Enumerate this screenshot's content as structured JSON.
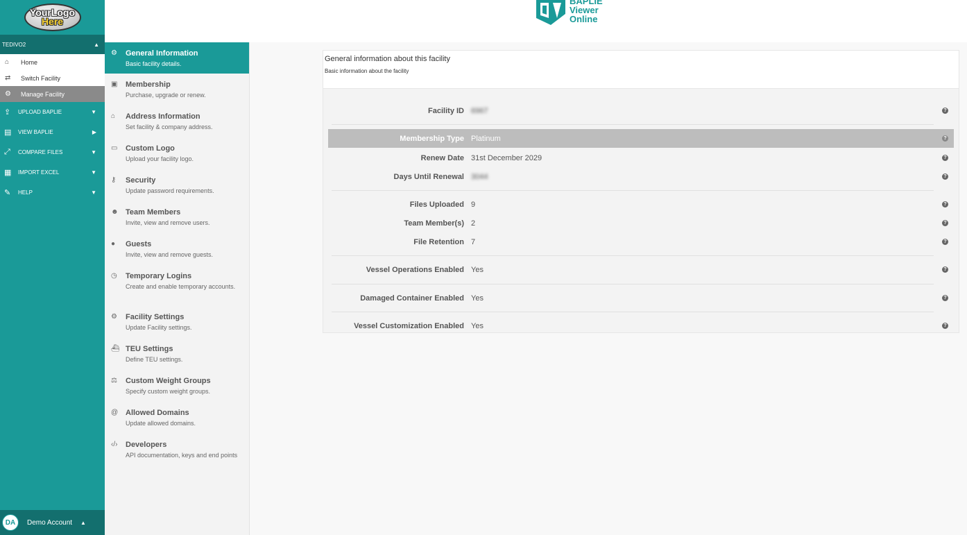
{
  "sidebar": {
    "logo": {
      "line1": "YourLogo",
      "line2": "Here"
    },
    "facility": {
      "name": "TEDIVO2"
    },
    "submenu": [
      {
        "label": "Home",
        "icon": "home-icon"
      },
      {
        "label": "Switch Facility",
        "icon": "shuffle-icon"
      },
      {
        "label": "Manage Facility",
        "icon": "cogs-icon"
      }
    ],
    "nav": [
      {
        "label": "Upload BAPLIE",
        "icon": "upload-icon"
      },
      {
        "label": "View BAPLIE",
        "icon": "document-icon"
      },
      {
        "label": "Compare Files",
        "icon": "compare-icon"
      },
      {
        "label": "Import Excel",
        "icon": "excel-icon"
      },
      {
        "label": "Help",
        "icon": "comments-icon"
      }
    ],
    "account": {
      "initials": "DA",
      "name": "Demo Account"
    }
  },
  "header": {
    "brand": {
      "line1": "BAPLIE",
      "line2": "Viewer",
      "line3": "Online"
    }
  },
  "settings_menu": [
    {
      "title": "General Information",
      "desc": "Basic facility details.",
      "icon": "gear-icon"
    },
    {
      "title": "Membership",
      "desc": "Purchase, upgrade or renew.",
      "icon": "money-icon"
    },
    {
      "title": "Address Information",
      "desc": "Set facility & company address.",
      "icon": "home-icon"
    },
    {
      "title": "Custom Logo",
      "desc": "Upload your facility logo.",
      "icon": "image-icon"
    },
    {
      "title": "Security",
      "desc": "Update password requirements.",
      "icon": "key-icon"
    },
    {
      "title": "Team Members",
      "desc": "Invite, view and remove users.",
      "icon": "users-icon"
    },
    {
      "title": "Guests",
      "desc": "Invite, view and remove guests.",
      "icon": "user-icon"
    },
    {
      "title": "Temporary Logins",
      "desc": "Create and enable temporary accounts.",
      "icon": "clock-icon"
    },
    {
      "title": "Facility Settings",
      "desc": "Update Facility settings.",
      "icon": "cogs-icon"
    },
    {
      "title": "TEU Settings",
      "desc": "Define TEU settings.",
      "icon": "ship-icon"
    },
    {
      "title": "Custom Weight Groups",
      "desc": "Specify custom weight groups.",
      "icon": "balance-scale-icon"
    },
    {
      "title": "Allowed Domains",
      "desc": "Update allowed domains.",
      "icon": "at-icon"
    },
    {
      "title": "Developers",
      "desc": "API documentation, keys and end points",
      "icon": "code-icon"
    }
  ],
  "main": {
    "title": "General information about this facility",
    "subtitle": "Basic information about the facility",
    "rows": [
      {
        "label": "Facility ID",
        "value": "6967"
      },
      {
        "label": "Membership Type",
        "value": "Platinum"
      },
      {
        "label": "Renew Date",
        "value": "31st December 2029"
      },
      {
        "label": "Days Until Renewal",
        "value": "3044"
      },
      {
        "label": "Files Uploaded",
        "value": "9"
      },
      {
        "label": "Team Member(s)",
        "value": "2"
      },
      {
        "label": "File Retention",
        "value": "7"
      },
      {
        "label": "Vessel Operations Enabled",
        "value": "Yes"
      },
      {
        "label": "Damaged Container Enabled",
        "value": "Yes"
      },
      {
        "label": "Vessel Customization Enabled",
        "value": "Yes"
      }
    ],
    "help_glyph": "?"
  },
  "colors": {
    "brand_teal": "#1a9a98",
    "dark_teal": "#136f6e",
    "highlight_row": "#bdbdbd",
    "active_submenu": "#8a8a8a"
  }
}
